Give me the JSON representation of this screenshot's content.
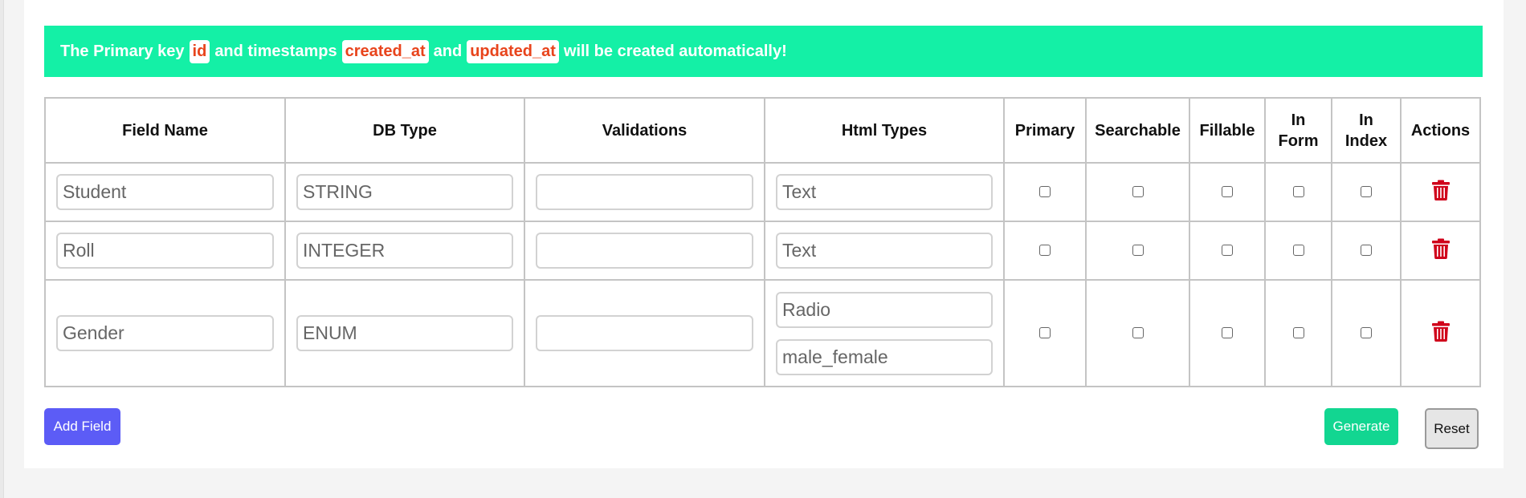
{
  "notice": {
    "text_1": "The Primary key",
    "code_1": "id",
    "text_2": "and timestamps",
    "code_2": "created_at",
    "text_3": "and",
    "code_3": "updated_at",
    "text_4": "will be created automatically!"
  },
  "table": {
    "headers": [
      "Field Name",
      "DB Type",
      "Validations",
      "Html Types",
      "Primary",
      "Searchable",
      "Fillable",
      "In Form",
      "In Index",
      "Actions"
    ],
    "rows": [
      {
        "field_name": "Student",
        "db_type": "STRING",
        "validations": "",
        "html_type": "Text",
        "html_options": null
      },
      {
        "field_name": "Roll",
        "db_type": "INTEGER",
        "validations": "",
        "html_type": "Text",
        "html_options": null
      },
      {
        "field_name": "Gender",
        "db_type": "ENUM",
        "validations": "",
        "html_type": "Radio",
        "html_options": "male_female"
      }
    ]
  },
  "buttons": {
    "add_field": "Add Field",
    "generate": "Generate",
    "reset": "Reset"
  },
  "icons": {
    "delete": "trash-icon"
  },
  "colors": {
    "notice_bg": "#14f0a6",
    "code_text": "#e8441c",
    "delete_icon": "#d0021b",
    "add_button": "#5c5cf6",
    "generate_button": "#12d691"
  }
}
